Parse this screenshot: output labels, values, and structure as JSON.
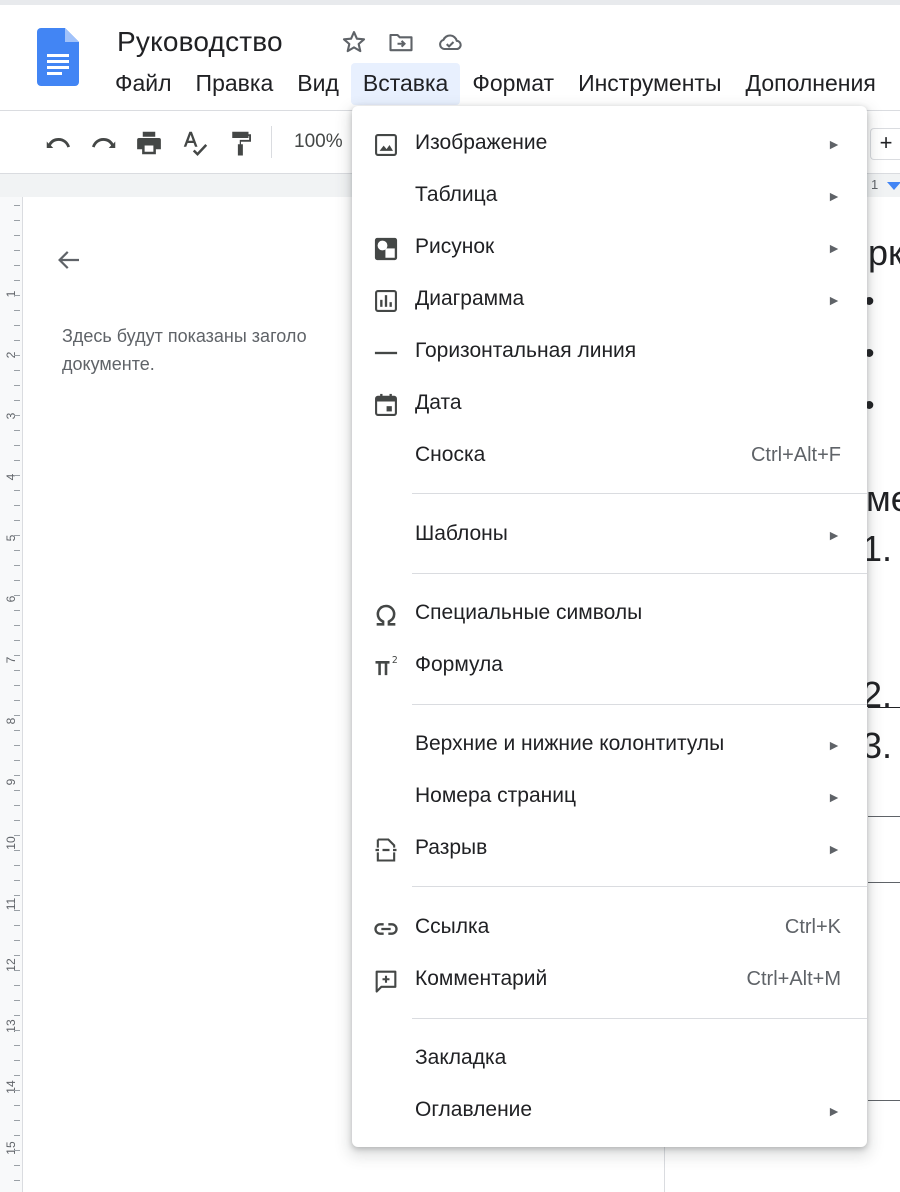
{
  "document": {
    "title": "Руководство"
  },
  "menubar": [
    "Файл",
    "Правка",
    "Вид",
    "Вставка",
    "Формат",
    "Инструменты",
    "Дополнения"
  ],
  "toolbar": {
    "zoom": "100%"
  },
  "outline": {
    "text_line1": "Здесь будут показаны заголо",
    "text_line2": "документе."
  },
  "ruler": {
    "vertical_numbers": [
      "1",
      "2",
      "3",
      "4",
      "5",
      "6",
      "7",
      "8",
      "9",
      "10",
      "11",
      "12",
      "13",
      "14",
      "15"
    ],
    "horizontal_mark": "1"
  },
  "page": {
    "add_button": "+",
    "fragments": [
      "рк",
      "•",
      "•",
      "•",
      "ме",
      "1.",
      "2.",
      "3."
    ]
  },
  "insert_menu": {
    "items": [
      {
        "label": "Изображение",
        "icon": "image-icon",
        "submenu": true,
        "shortcut": ""
      },
      {
        "label": "Таблица",
        "icon": "",
        "submenu": true,
        "shortcut": ""
      },
      {
        "label": "Рисунок",
        "icon": "drawing-icon",
        "submenu": true,
        "shortcut": ""
      },
      {
        "label": "Диаграмма",
        "icon": "chart-icon",
        "submenu": true,
        "shortcut": ""
      },
      {
        "label": "Горизонтальная линия",
        "icon": "horizontal-line-icon",
        "submenu": false,
        "shortcut": ""
      },
      {
        "label": "Дата",
        "icon": "calendar-icon",
        "submenu": false,
        "shortcut": ""
      },
      {
        "label": "Сноска",
        "icon": "",
        "submenu": false,
        "shortcut": "Ctrl+Alt+F"
      },
      {
        "label": "Шаблоны",
        "icon": "",
        "submenu": true,
        "shortcut": ""
      },
      {
        "label": "Специальные символы",
        "icon": "omega-icon",
        "submenu": false,
        "shortcut": ""
      },
      {
        "label": "Формула",
        "icon": "pi-icon",
        "submenu": false,
        "shortcut": ""
      },
      {
        "label": "Верхние и нижние колонтитулы",
        "icon": "",
        "submenu": true,
        "shortcut": ""
      },
      {
        "label": "Номера страниц",
        "icon": "",
        "submenu": true,
        "shortcut": ""
      },
      {
        "label": "Разрыв",
        "icon": "page-break-icon",
        "submenu": true,
        "shortcut": ""
      },
      {
        "label": "Ссылка",
        "icon": "link-icon",
        "submenu": false,
        "shortcut": "Ctrl+K"
      },
      {
        "label": "Комментарий",
        "icon": "comment-add-icon",
        "submenu": false,
        "shortcut": "Ctrl+Alt+M"
      },
      {
        "label": "Закладка",
        "icon": "",
        "submenu": false,
        "shortcut": ""
      },
      {
        "label": "Оглавление",
        "icon": "",
        "submenu": true,
        "shortcut": ""
      }
    ],
    "submenu_arrow": "►"
  },
  "colors": {
    "accent_blue": "#4285f4",
    "active_menu_bg": "#e8f0fe"
  }
}
